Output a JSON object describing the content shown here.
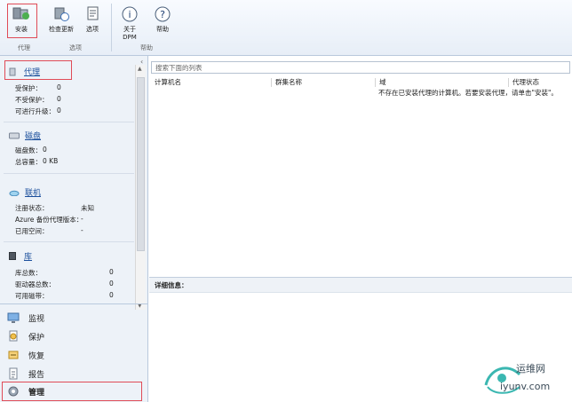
{
  "ribbon": {
    "buttons": {
      "install": "安装",
      "check_update": "检查更新",
      "options": "选项",
      "about": "关于 DPM",
      "help": "帮助"
    },
    "groups": {
      "agent": "代理",
      "options": "选项",
      "help": "帮助"
    }
  },
  "sidebar": {
    "agent": {
      "title": "代理",
      "rows": [
        {
          "label": "受保护：",
          "value": "0"
        },
        {
          "label": "不受保护：",
          "value": "0"
        },
        {
          "label": "可进行升级：",
          "value": "0"
        }
      ]
    },
    "disk": {
      "title": "磁盘",
      "rows": [
        {
          "label": "磁盘数：",
          "value": "0"
        },
        {
          "label": "总容量：",
          "value": "0 KB"
        }
      ]
    },
    "online": {
      "title": "联机",
      "rows": [
        {
          "label": "注册状态：",
          "value": "未知"
        },
        {
          "label": "Azure 备份代理版本：",
          "value": "-"
        },
        {
          "label": "已用空间：",
          "value": "-"
        }
      ]
    },
    "library": {
      "title": "库",
      "rows": [
        {
          "label": "库总数：",
          "value": "0"
        },
        {
          "label": "驱动器总数：",
          "value": "0"
        },
        {
          "label": "可用磁带：",
          "value": "0"
        }
      ]
    },
    "nav": [
      "监视",
      "保护",
      "恢复",
      "报告",
      "管理"
    ]
  },
  "main": {
    "search_placeholder": "搜索下面的列表",
    "columns": [
      "计算机名",
      "群集名称",
      "域",
      "代理状态"
    ],
    "empty_message": "不存在已安装代理的计算机。若要安装代理，请单击\"安装\"。",
    "details_label": "详细信息："
  },
  "watermark": {
    "name": "运维网",
    "url": "iyunv.com"
  }
}
